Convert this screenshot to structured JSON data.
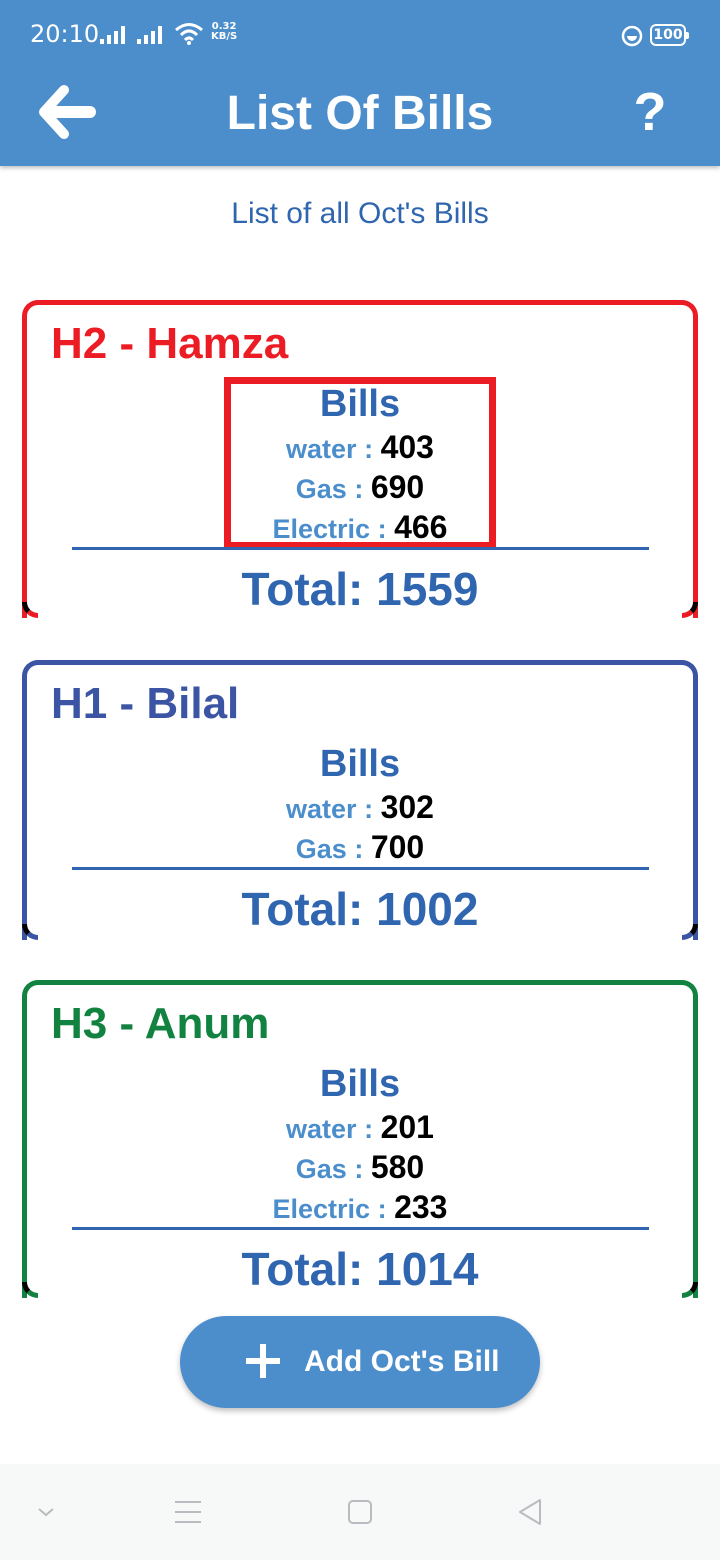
{
  "status_bar": {
    "time": "20:10",
    "speed_value": "0.32",
    "speed_unit": "KB/S",
    "battery": "100"
  },
  "header": {
    "title": "List Of Bills",
    "help": "?",
    "back_icon": "back-arrow-icon"
  },
  "subtitle": "List of all Oct's Bills",
  "cards": [
    {
      "title": "H2 - Hamza",
      "accent": "#ec1c24",
      "bills_heading": "Bills",
      "water_label": "water : ",
      "water_value": "403",
      "gas_label": "Gas : ",
      "gas_value": "690",
      "electric_label": "Electric : ",
      "electric_value": "466",
      "total": "Total: 1559"
    },
    {
      "title": "H1 - Bilal",
      "accent": "#3b55a4",
      "bills_heading": "Bills",
      "water_label": "water : ",
      "water_value": "302",
      "gas_label": "Gas : ",
      "gas_value": "700",
      "total": "Total: 1002"
    },
    {
      "title": "H3 - Anum",
      "accent": "#128240",
      "bills_heading": "Bills",
      "water_label": "water : ",
      "water_value": "201",
      "gas_label": "Gas : ",
      "gas_value": "580",
      "electric_label": "Electric : ",
      "electric_value": "233",
      "total": "Total: 1014"
    }
  ],
  "add_button": {
    "label": "Add Oct's Bill",
    "icon": "plus-icon"
  },
  "colors": {
    "primary": "#4c8ecb",
    "text_blue": "#3066b0"
  }
}
